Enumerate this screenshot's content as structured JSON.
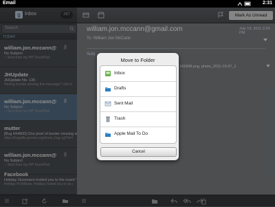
{
  "status_bar": {
    "app_name": "Email",
    "time": "2:31"
  },
  "left_pane": {
    "title": "Inbox",
    "count": "267",
    "search_placeholder": "Search",
    "section": "TODAY",
    "messages": [
      {
        "from": "william.jon.mccann@",
        "subject": "No Subject",
        "preview": "-- Sent from my HP TouchPad",
        "has_attachment": true
      },
      {
        "from": "JHUpdate",
        "subject": "JHUpdate No. 135",
        "preview": "Having trouble viewing this message? click h",
        "has_attachment": false
      },
      {
        "from": "william.jon.mccann@",
        "subject": "No Subject",
        "preview": "-- Sent from my HP TouchPad",
        "has_attachment": true
      },
      {
        "from": "mutter",
        "subject": "[Bug 644800] One pixel of border missing is f",
        "preview": "https://bugzilla.gnome.org/show_bug.cgi?id=6",
        "has_attachment": false
      },
      {
        "from": "william.jon.mccann@",
        "subject": "No Subject",
        "preview": "-- Sent from my HP TouchPad",
        "has_attachment": true
      },
      {
        "from": "Facebook",
        "subject": "Holiday Gissmann invited you to the event \"Pa",
        "preview": "Holiday Hi William, Holiday invited you to an e",
        "has_attachment": false
      }
    ]
  },
  "right_pane": {
    "from": "william.jon.mccann@gmail.com",
    "date": "July 19, 2011 2:29 PM",
    "to_label": "To:",
    "to_name": "William Jon McCann",
    "subject_label": "Subj",
    "attachment_name": "2011-19-07_141848.png, photo_2011-19-07_1",
    "mark_button": "Mark As Unread"
  },
  "dialog": {
    "title": "Move to Folder",
    "folders": [
      {
        "label": "Inbox",
        "icon": "inbox-icon"
      },
      {
        "label": "Drafts",
        "icon": "drafts-icon"
      },
      {
        "label": "Sent Mail",
        "icon": "sent-mail-icon"
      },
      {
        "label": "Trash",
        "icon": "trash-icon"
      },
      {
        "label": "Apple Mail To Do",
        "icon": "folder-icon"
      }
    ],
    "cancel_label": "Cancel"
  },
  "colors": {
    "selected_row": "#566e86",
    "accent": "#9fb8cf"
  }
}
